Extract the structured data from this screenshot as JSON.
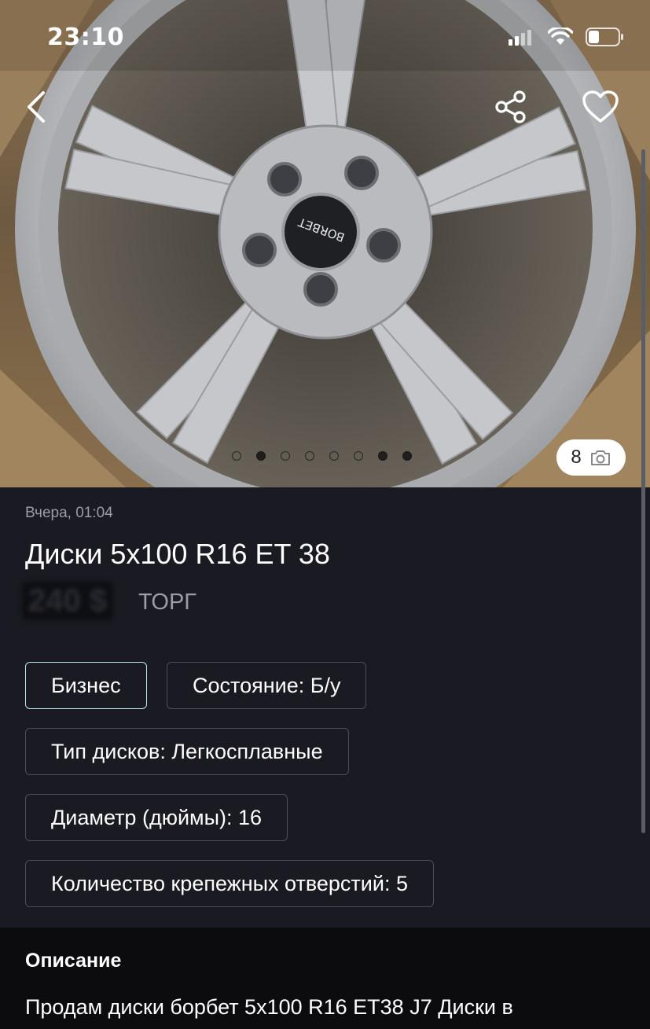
{
  "status_bar": {
    "time": "23:10"
  },
  "gallery": {
    "photo_count": "8",
    "total_dots": 8,
    "filled_dots": [
      1,
      6,
      7
    ],
    "image_text": "BORBET"
  },
  "listing": {
    "posted": "Вчера, 01:04",
    "title": "Диски 5x100 R16 ET 38",
    "price": "240 $",
    "negotiable": "ТОРГ"
  },
  "attributes": [
    "Бизнес",
    "Состояние: Б/у",
    "Тип дисков: Легкосплавные",
    "Диаметр (дюймы): 16",
    "Количество крепежных отверстий: 5"
  ],
  "description": {
    "heading": "Описание",
    "text": "Продам диски борбет 5x100 R16 ET38 J7 Диски в"
  },
  "colors": {
    "background": "#1a1b22",
    "chip_border": "#4c4e58",
    "chip_active_border": "#b9e6ef",
    "muted_text": "#9a9ca6"
  },
  "icons": {
    "back": "chevron-left-icon",
    "share": "share-icon",
    "favorite": "heart-icon",
    "camera": "camera-icon",
    "signal": "signal-icon",
    "wifi": "wifi-icon",
    "battery": "battery-icon"
  }
}
